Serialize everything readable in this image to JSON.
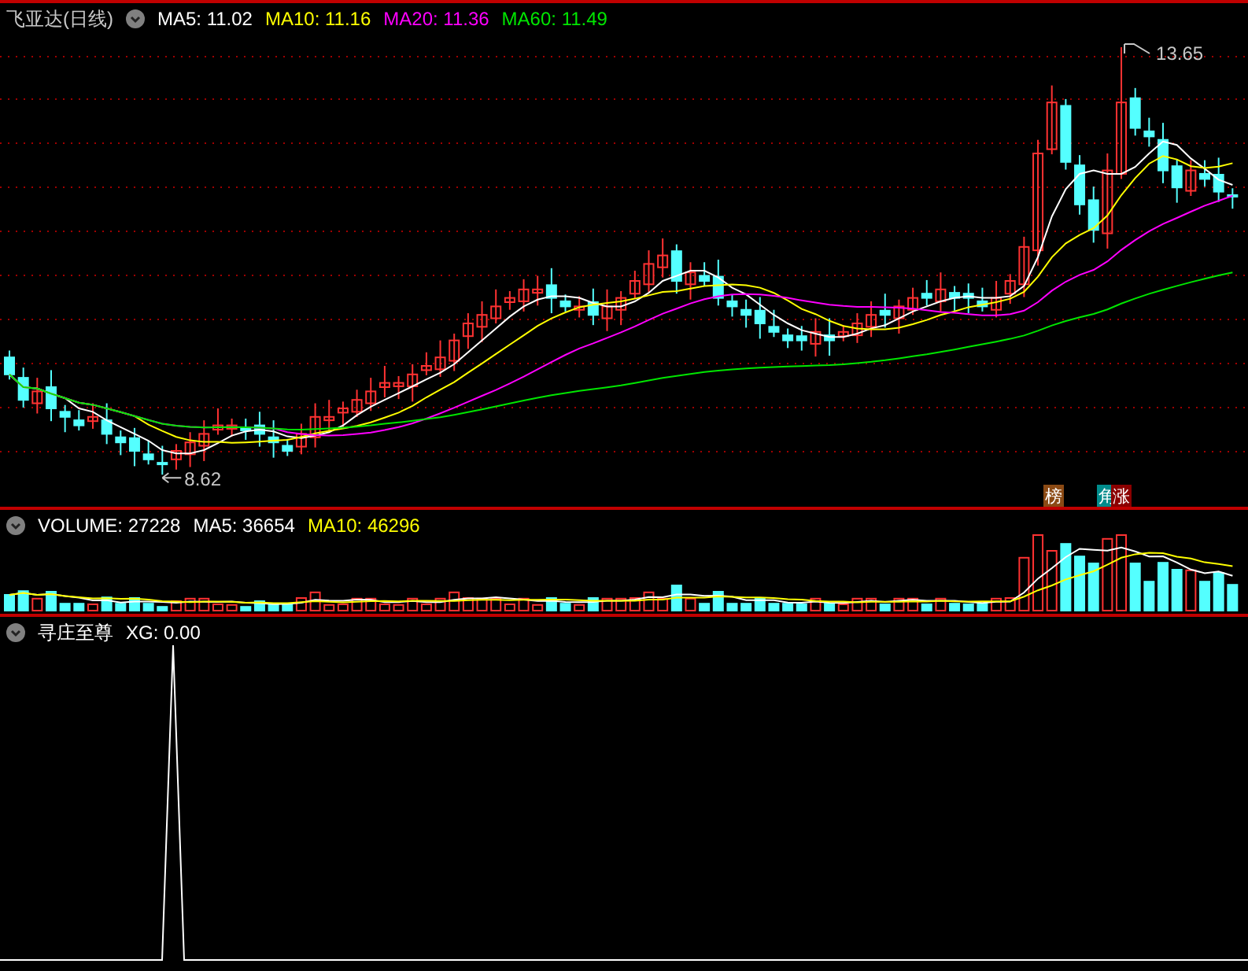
{
  "stock": {
    "title": "飞亚达(日线)",
    "ma": [
      {
        "label": "MA5: 11.02",
        "color": "#ffffff"
      },
      {
        "label": "MA10: 11.16",
        "color": "#ffff00"
      },
      {
        "label": "MA20: 11.36",
        "color": "#ff00ff"
      },
      {
        "label": "MA60: 11.49",
        "color": "#00e600"
      }
    ]
  },
  "price_chart": {
    "high_label": "13.65",
    "low_label": "8.62",
    "badges": [
      {
        "text": "榜",
        "color": "#8b4a14"
      },
      {
        "text": "角",
        "color": "#008c8c"
      },
      {
        "text": "涨",
        "color": "#8b0000"
      }
    ]
  },
  "volume": {
    "items": [
      {
        "label": "VOLUME: 27228",
        "color": "#ffffff"
      },
      {
        "label": "MA5: 36654",
        "color": "#ffffff"
      },
      {
        "label": "MA10: 46296",
        "color": "#ffff00"
      }
    ]
  },
  "indicator": {
    "items": [
      {
        "label": "寻庄至尊",
        "color": "#ffffff"
      },
      {
        "label": "XG: 0.00",
        "color": "#ffffff"
      }
    ]
  }
}
